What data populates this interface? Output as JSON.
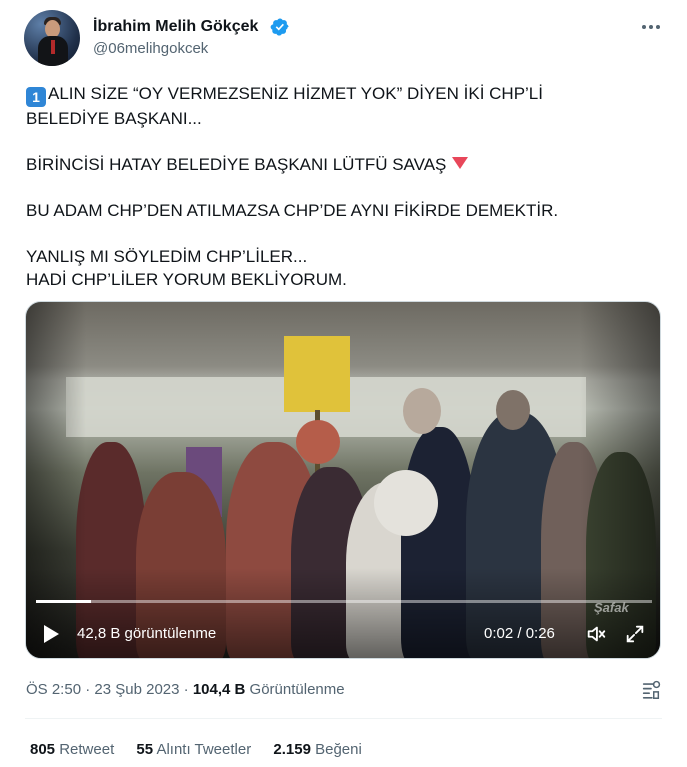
{
  "author": {
    "name": "İbrahim Melih Gökçek",
    "handle": "@06melihgokcek"
  },
  "tweet": {
    "keycap": "1",
    "line1": "ALIN SİZE “OY VERMEZSENİZ HİZMET YOK” DİYEN İKİ CHP’Lİ",
    "line2": "BELEDİYE BAŞKANI...",
    "line3": "BİRİNCİSİ HATAY BELEDİYE BAŞKANI LÜTFÜ SAVAŞ",
    "line4": "BU ADAM CHP’DEN ATILMAZSA CHP’DE AYNI FİKİRDE DEMEKTİR.",
    "line5": "YANLIŞ MI SÖYLEDİM CHP’LİLER...",
    "line6": "HADİ CHP’LİLER YORUM BEKLİYORUM."
  },
  "video": {
    "views": "42,8 B görüntülenme",
    "time": "0:02 / 0:26",
    "progress": 0.09,
    "watermark": "Şafak"
  },
  "meta": {
    "time": "ÖS 2:50",
    "sep1": " · ",
    "date": "23 Şub 2023",
    "sep2": " · ",
    "views_count": "104,4 B",
    "views_label": "Görüntülenme"
  },
  "stats": {
    "retweets": "805",
    "retweets_label": "Retweet",
    "quotes": "55",
    "quotes_label": "Alıntı Tweetler",
    "likes": "2.159",
    "likes_label": "Beğeni"
  },
  "colors": {
    "verified": "#1d9bf0",
    "text": "#0f1419",
    "muted": "#536471",
    "keycap": "#2f86d6",
    "triangle": "#e8475a"
  }
}
